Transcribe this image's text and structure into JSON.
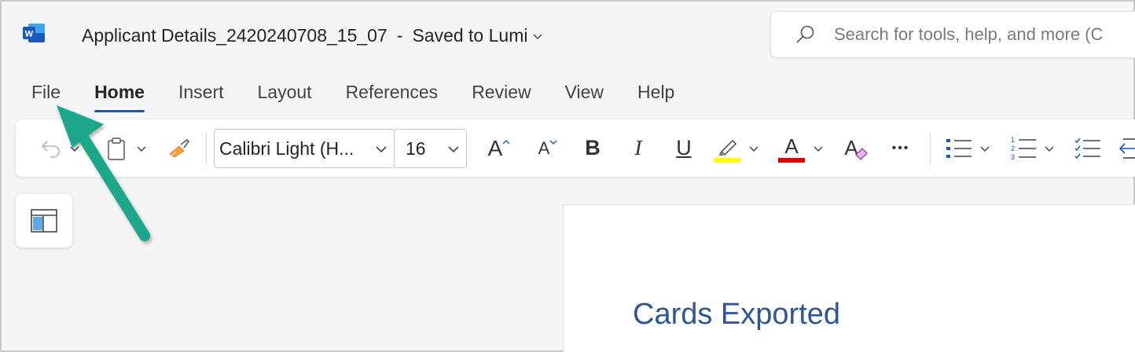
{
  "app": {
    "icon": "word-logo-icon"
  },
  "title_bar": {
    "doc_name": "Applicant Details_2420240708_15_07",
    "separator": "-",
    "save_status": "Saved to Lumi"
  },
  "search": {
    "placeholder": "Search for tools, help, and more (C"
  },
  "tabs": [
    {
      "label": "File"
    },
    {
      "label": "Home",
      "active": true
    },
    {
      "label": "Insert"
    },
    {
      "label": "Layout"
    },
    {
      "label": "References"
    },
    {
      "label": "Review"
    },
    {
      "label": "View"
    },
    {
      "label": "Help"
    }
  ],
  "ribbon": {
    "font_name": "Calibri Light (H...",
    "font_size": "16",
    "grow_font": "A",
    "shrink_font": "A",
    "bold": "B",
    "italic": "I",
    "underline": "U",
    "font_color_glyph": "A",
    "clear_format_glyph": "A",
    "more": "•••",
    "highlight_color": "#ffff00",
    "font_color": "#e00000"
  },
  "document": {
    "heading": "Cards Exported",
    "heading_color": "#2f5597"
  },
  "annotation": {
    "arrow_color": "#1ba78a"
  }
}
